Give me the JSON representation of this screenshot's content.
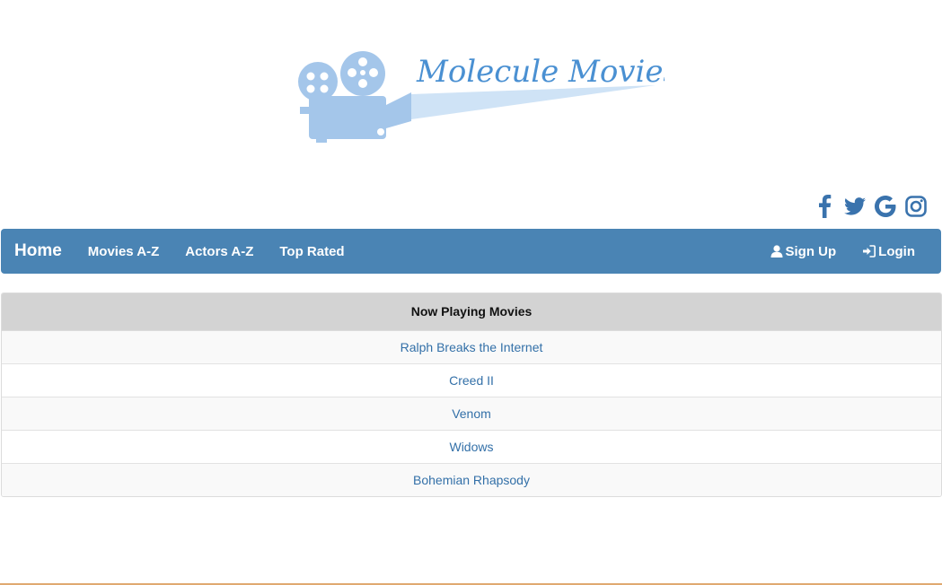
{
  "brand": {
    "logo_text": "Molecule Movies"
  },
  "social": [
    {
      "icon": "facebook-icon"
    },
    {
      "icon": "twitter-icon"
    },
    {
      "icon": "google-icon"
    },
    {
      "icon": "instagram-icon"
    }
  ],
  "nav": {
    "home": "Home",
    "links": [
      "Movies A-Z",
      "Actors A-Z",
      "Top Rated"
    ],
    "signup": "Sign Up",
    "login": "Login"
  },
  "now_playing": {
    "header": "Now Playing Movies",
    "movies": [
      "Ralph Breaks the Internet",
      "Creed II",
      "Venom",
      "Widows",
      "Bohemian Rhapsody"
    ]
  },
  "colors": {
    "navbar": "#4a84b4",
    "link": "#3370a8",
    "social": "#3a73ad",
    "header_bg": "#d3d3d3"
  }
}
